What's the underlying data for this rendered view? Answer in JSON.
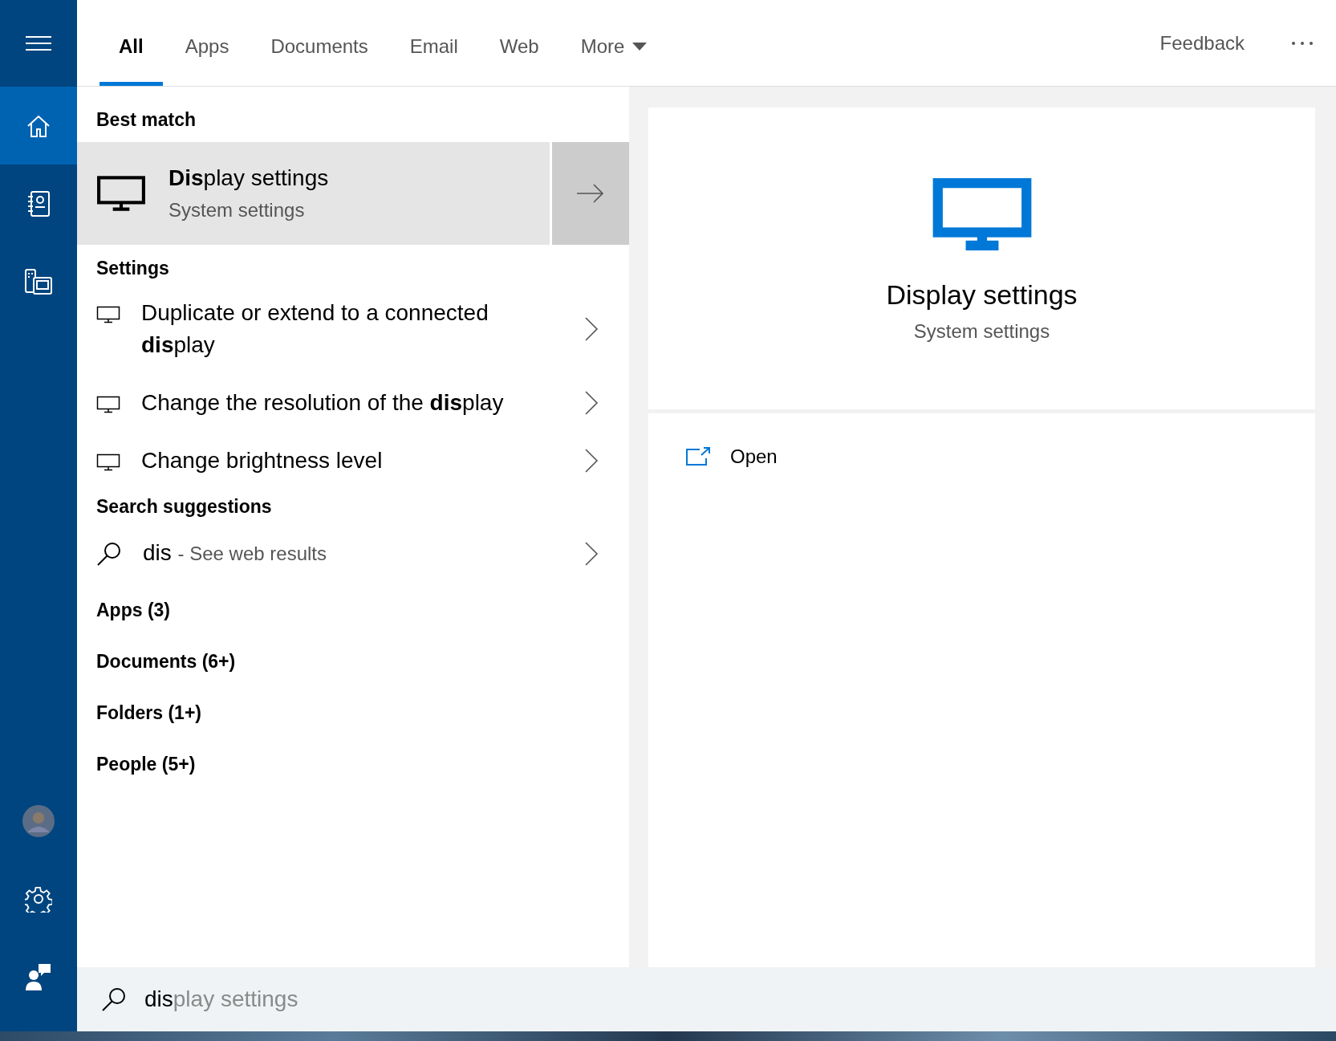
{
  "sidebar": {
    "top_items": [
      {
        "selected": false
      },
      {
        "selected": true
      },
      {
        "selected": false
      },
      {
        "selected": false
      }
    ],
    "bottom_items": [
      {
        "selected": false
      },
      {
        "selected": false
      },
      {
        "selected": false
      }
    ]
  },
  "tabs": [
    {
      "label": "All",
      "selected": true,
      "kind": "tab"
    },
    {
      "label": "Apps",
      "selected": false,
      "kind": "tab"
    },
    {
      "label": "Documents",
      "selected": false,
      "kind": "tab"
    },
    {
      "label": "Email",
      "selected": false,
      "kind": "tab"
    },
    {
      "label": "Web",
      "selected": false,
      "kind": "tab"
    },
    {
      "label": "More",
      "selected": false,
      "kind": "dropdown"
    }
  ],
  "feedback": "Feedback",
  "best_match": {
    "heading": "Best match",
    "title": "**Dis**play settings",
    "subtitle": "System settings",
    "selected": true
  },
  "settings": {
    "heading": "Settings",
    "items": [
      "Duplicate or extend to a connected **dis**play",
      "Change the resolution of the **dis**play",
      "Change brightness level"
    ]
  },
  "suggestions": {
    "heading": "Search suggestions",
    "items": [
      {
        "query": "dis",
        "hint": "- See web results"
      }
    ]
  },
  "categories": [
    "Apps (3)",
    "Documents (6+)",
    "Folders (1+)",
    "People (5+)"
  ],
  "detail": {
    "title": "Display settings",
    "subtitle": "System settings",
    "actions": [
      "Open"
    ]
  },
  "search": {
    "typed": "dis",
    "suggestion": "play settings"
  }
}
